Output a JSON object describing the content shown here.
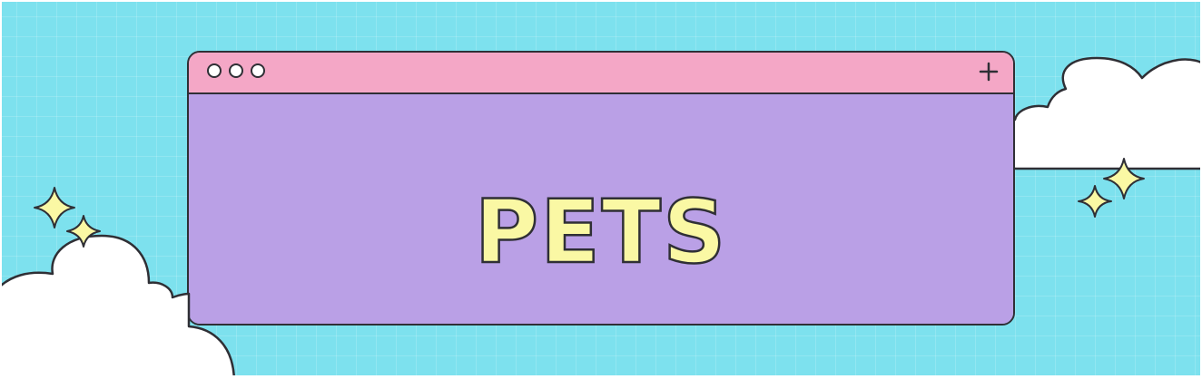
{
  "banner": {
    "title": "PETS"
  },
  "window": {
    "titlebar_dots": 3,
    "titlebar_action_icon": "plus-icon"
  },
  "colors": {
    "background": "#7de1ee",
    "window_content": "#baa0e6",
    "titlebar": "#f4a7c6",
    "title_text": "#faf8a4",
    "outline": "#2f2f35",
    "cloud": "#ffffff",
    "sparkle": "#faf8a4"
  }
}
